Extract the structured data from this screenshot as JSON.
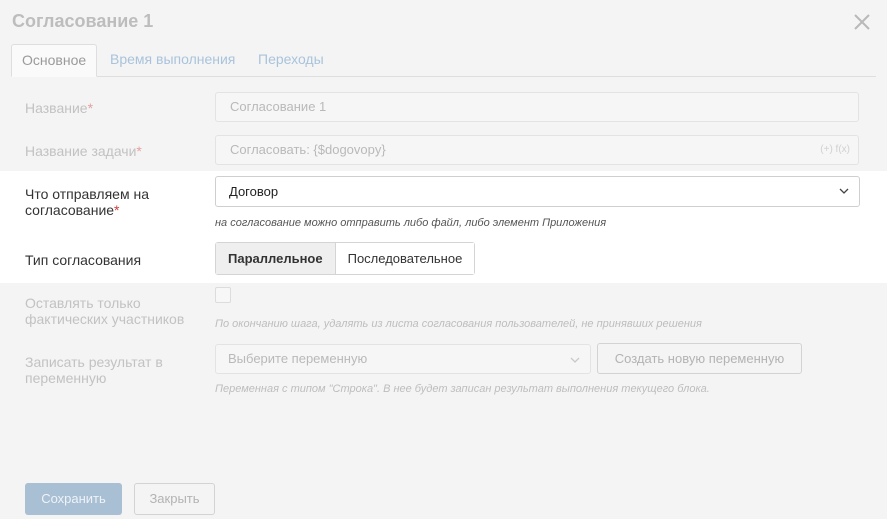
{
  "dialog": {
    "title": "Согласование 1"
  },
  "tabs": [
    {
      "label": "Основное"
    },
    {
      "label": "Время выполнения"
    },
    {
      "label": "Переходы"
    }
  ],
  "form": {
    "name": {
      "label": "Название",
      "value": "Согласование 1"
    },
    "task_name": {
      "label": "Название задачи",
      "value": "Согласовать: {$dogovopy}",
      "fx_hint": "(+) f(x)"
    },
    "send": {
      "label": "Что отправляем на согласование",
      "value": "Договор",
      "hint": "на согласование можно отправить либо файл, либо элемент Приложения"
    },
    "type": {
      "label": "Тип согласования",
      "options": [
        "Параллельное",
        "Последовательное"
      ],
      "selected": "Параллельное"
    },
    "actual_only": {
      "label": "Оставлять только фактических участников",
      "hint": "По окончанию шага, удалять из листа согласования пользователей, не принявших решения"
    },
    "result_var": {
      "label": "Записать результат в переменную",
      "placeholder": "Выберите переменную",
      "create_label": "Создать новую переменную",
      "hint": "Переменная с типом \"Строка\". В нее будет записан результат выполнения текущего блока."
    }
  },
  "footer": {
    "save_label": "Сохранить",
    "close_label": "Закрыть"
  }
}
